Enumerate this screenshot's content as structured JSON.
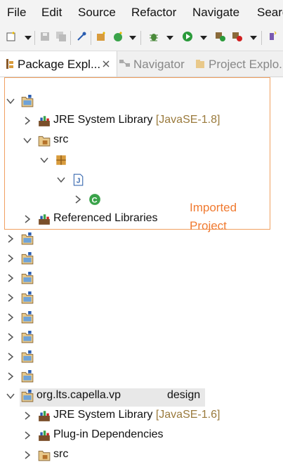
{
  "menu": [
    "File",
    "Edit",
    "Source",
    "Refactor",
    "Navigate",
    "Search"
  ],
  "tabs": {
    "package_explorer": "Package Expl...",
    "navigator": "Navigator",
    "project_explorer": "Project Explo..."
  },
  "tree": {
    "jre_label": "JRE System Library",
    "jre_version_1": "[JavaSE-1.8]",
    "src_label": "src",
    "referenced_libraries": "Referenced Libraries",
    "project_name_a": "org.lts.capella.vp",
    "project_name_b": "design",
    "jre_version_2": "[JavaSE-1.6]",
    "plugin_dependencies": "Plug-in Dependencies",
    "src_label_2": "src"
  },
  "annotation": {
    "line1": "Imported",
    "line2": "Project",
    "color": "#f07a30"
  },
  "icons": {
    "project": "project-folder-icon",
    "library": "library-icon",
    "package_folder": "source-folder-icon",
    "package": "package-icon",
    "java_file": "java-file-icon",
    "class": "class-icon"
  }
}
